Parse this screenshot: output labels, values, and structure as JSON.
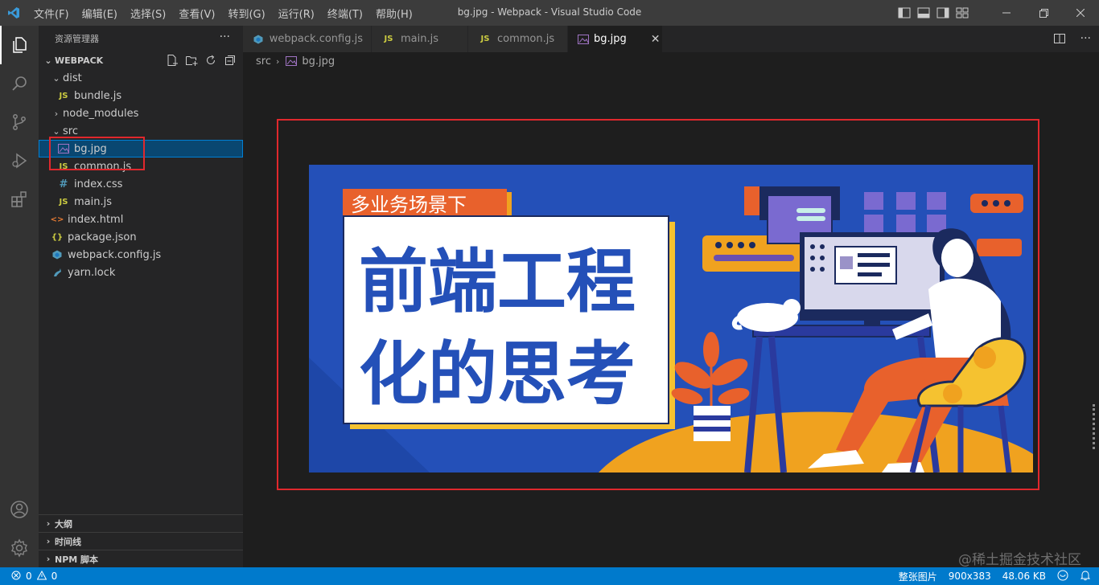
{
  "window": {
    "title": "bg.jpg - Webpack - Visual Studio Code",
    "menu": [
      "文件(F)",
      "编辑(E)",
      "选择(S)",
      "查看(V)",
      "转到(G)",
      "运行(R)",
      "终端(T)",
      "帮助(H)"
    ]
  },
  "sidebar": {
    "title": "资源管理器",
    "more": "···",
    "root": "WEBPACK",
    "tree": [
      {
        "label": "dist",
        "kind": "folder-open"
      },
      {
        "label": "bundle.js",
        "kind": "js"
      },
      {
        "label": "node_modules",
        "kind": "folder-closed"
      },
      {
        "label": "src",
        "kind": "folder-open"
      },
      {
        "label": "bg.jpg",
        "kind": "image"
      },
      {
        "label": "common.js",
        "kind": "js"
      },
      {
        "label": "index.css",
        "kind": "css"
      },
      {
        "label": "main.js",
        "kind": "js"
      },
      {
        "label": "index.html",
        "kind": "html"
      },
      {
        "label": "package.json",
        "kind": "json"
      },
      {
        "label": "webpack.config.js",
        "kind": "webpack"
      },
      {
        "label": "yarn.lock",
        "kind": "yarn"
      }
    ],
    "bottom_sections": [
      "大纲",
      "时间线",
      "NPM 脚本"
    ]
  },
  "tabs": [
    {
      "label": "webpack.config.js",
      "icon": "webpack-icon"
    },
    {
      "label": "main.js",
      "icon": "js-icon"
    },
    {
      "label": "common.js",
      "icon": "js-icon"
    },
    {
      "label": "bg.jpg",
      "icon": "image-icon",
      "active": true
    }
  ],
  "breadcrumb": [
    "src",
    "bg.jpg"
  ],
  "banner": {
    "tag": "多业务场景下",
    "line1": "前端工程",
    "line2": "化的思考"
  },
  "statusbar": {
    "errors": "0",
    "warnings": "0",
    "fit": "整张图片",
    "dimensions": "900x383",
    "size": "48.06 KB"
  },
  "watermark": "@稀土掘金技术社区",
  "icons": {
    "js": "JS",
    "css": "#",
    "html": "<>",
    "json": "{}"
  },
  "colors": {
    "accent": "#007acc",
    "highlight": "#e0282d",
    "banner_blue": "#2450b8",
    "banner_orange": "#f0a21f"
  }
}
